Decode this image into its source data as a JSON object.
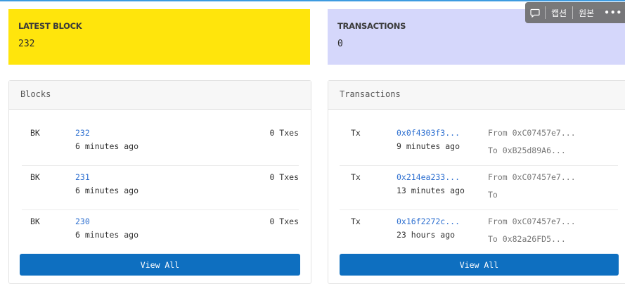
{
  "stats": {
    "latest_block": {
      "label": "LATEST BLOCK",
      "value": "232",
      "color": "#ffe50c"
    },
    "transactions": {
      "label": "TRANSACTIONS",
      "value": "0",
      "color": "#d5d7fb"
    }
  },
  "overlay": {
    "caption_label": "캡션",
    "original_label": "원본",
    "more": "•••",
    "icon": "speech-bubble-icon"
  },
  "blocks": {
    "title": "Blocks",
    "rows": [
      {
        "tag": "BK",
        "number": "232",
        "age": "6 minutes ago",
        "txes": "0 Txes"
      },
      {
        "tag": "BK",
        "number": "231",
        "age": "6 minutes ago",
        "txes": "0 Txes"
      },
      {
        "tag": "BK",
        "number": "230",
        "age": "6 minutes ago",
        "txes": "0 Txes"
      }
    ],
    "view_all": "View All"
  },
  "transactions": {
    "title": "Transactions",
    "rows": [
      {
        "tag": "Tx",
        "hash": "0x0f4303f3...",
        "age": "9 minutes ago",
        "from": "From 0xC07457e7...",
        "to": "To 0xB25d89A6..."
      },
      {
        "tag": "Tx",
        "hash": "0x214ea233...",
        "age": "13 minutes ago",
        "from": "From 0xC07457e7...",
        "to": "To"
      },
      {
        "tag": "Tx",
        "hash": "0x16f2272c...",
        "age": "23 hours ago",
        "from": "From 0xC07457e7...",
        "to": "To 0x82a26FD5..."
      }
    ],
    "view_all": "View All"
  },
  "colors": {
    "accent_button": "#0e6fc0",
    "link": "#2d6fd0"
  }
}
